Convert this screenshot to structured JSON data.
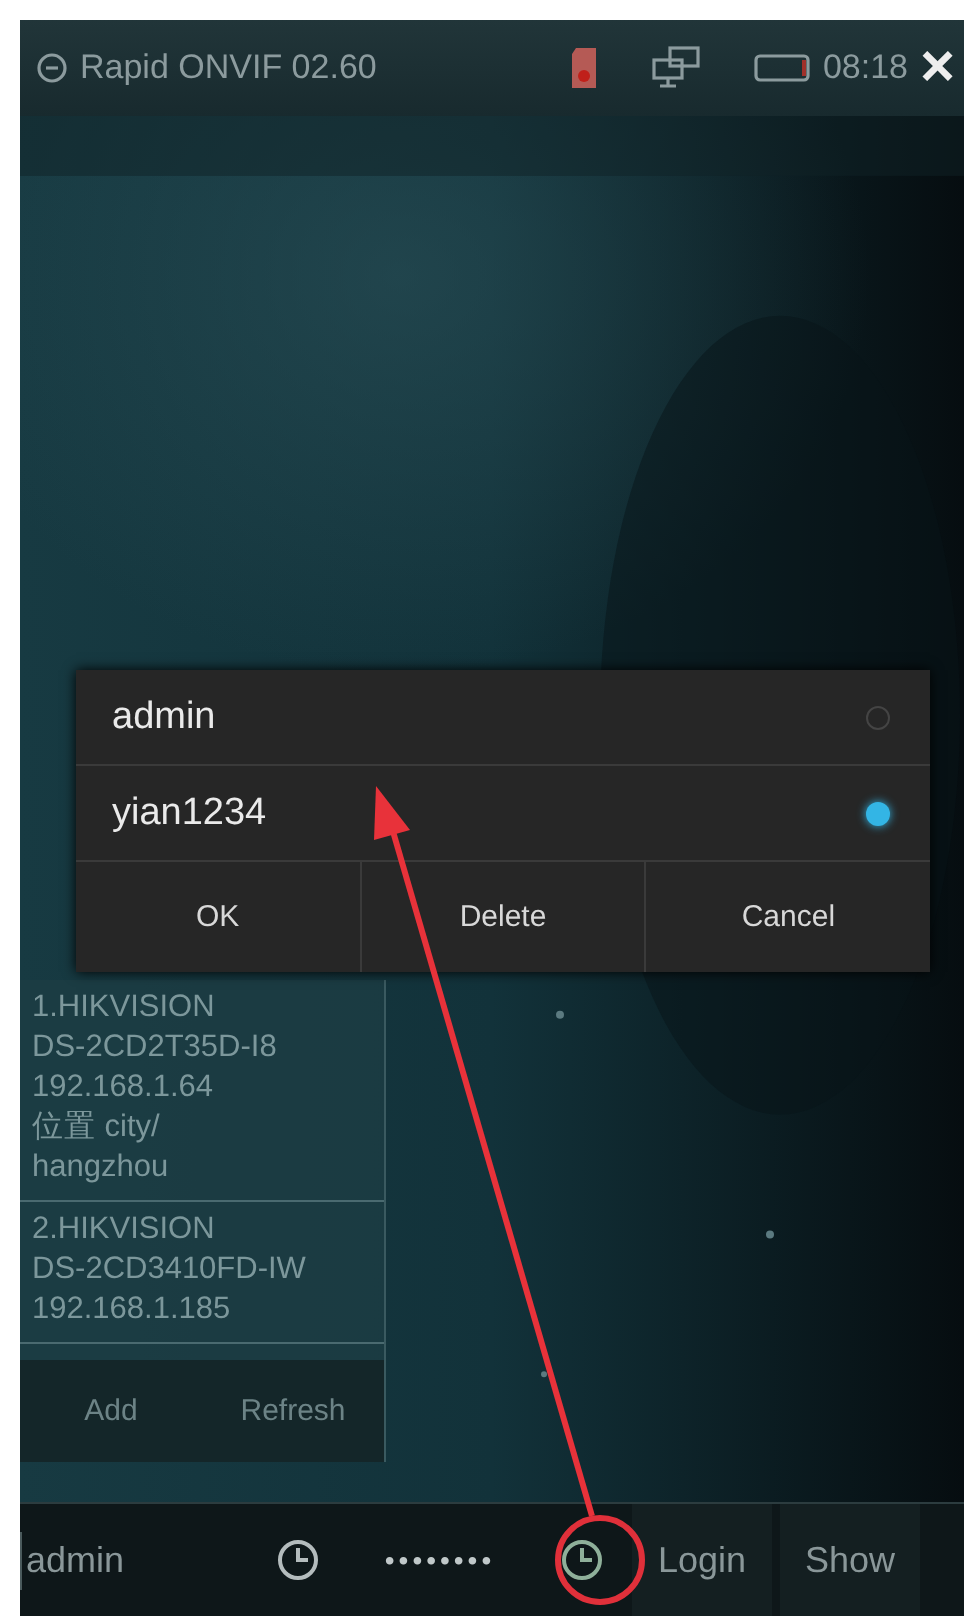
{
  "title_bar": {
    "title": "Rapid ONVIF 02.60",
    "time": "08:18",
    "close": "×"
  },
  "dialog": {
    "options": [
      {
        "label": "admin",
        "selected": false
      },
      {
        "label": "yian1234",
        "selected": true
      }
    ],
    "buttons": [
      "OK",
      "Delete",
      "Cancel"
    ]
  },
  "devices": [
    {
      "lines": [
        "1.HIKVISION",
        "DS-2CD2T35D-I8",
        "192.168.1.64",
        "位置 city/",
        "hangzhou"
      ]
    },
    {
      "lines": [
        "2.HIKVISION",
        "DS-2CD3410FD-IW",
        "192.168.1.185"
      ]
    }
  ],
  "device_buttons": [
    "Add",
    "Refresh"
  ],
  "login_bar": {
    "username": "admin",
    "password": "••••••••",
    "buttons": [
      "Login",
      "Show"
    ]
  }
}
